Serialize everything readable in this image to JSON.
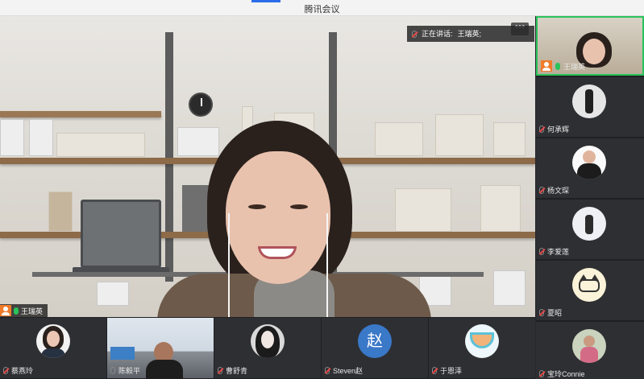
{
  "window": {
    "title": "腾讯会议"
  },
  "main_video": {
    "options_label": "•••",
    "speaking_prefix": "正在讲话:",
    "speaking_name": "王瑞英;",
    "participant_name": "王瑞英"
  },
  "right_column": {
    "participants": [
      {
        "name": "王瑞英",
        "mic": "on",
        "active": true,
        "host": true
      },
      {
        "name": "何承辉",
        "mic": "muted"
      },
      {
        "name": "杨文琛",
        "mic": "muted"
      },
      {
        "name": "李爱莲",
        "mic": "muted"
      },
      {
        "name": "夏昭",
        "mic": "muted"
      },
      {
        "name": "宝玲Connie",
        "mic": "muted"
      }
    ]
  },
  "bottom_strip": {
    "participants": [
      {
        "name": "蔡燕玲",
        "mic": "muted"
      },
      {
        "name": "陈毅平",
        "mic": "muted"
      },
      {
        "name": "曹舒青",
        "mic": "muted"
      },
      {
        "name": "Steven赵",
        "mic": "muted",
        "avatar_text": "赵"
      },
      {
        "name": "于恩泽",
        "mic": "muted"
      }
    ]
  },
  "colors": {
    "accent": "#2b6de8",
    "mic_on": "#29c35a",
    "mic_muted": "#e54848",
    "host_badge": "#f07b2b",
    "active_border": "#29c35a"
  }
}
